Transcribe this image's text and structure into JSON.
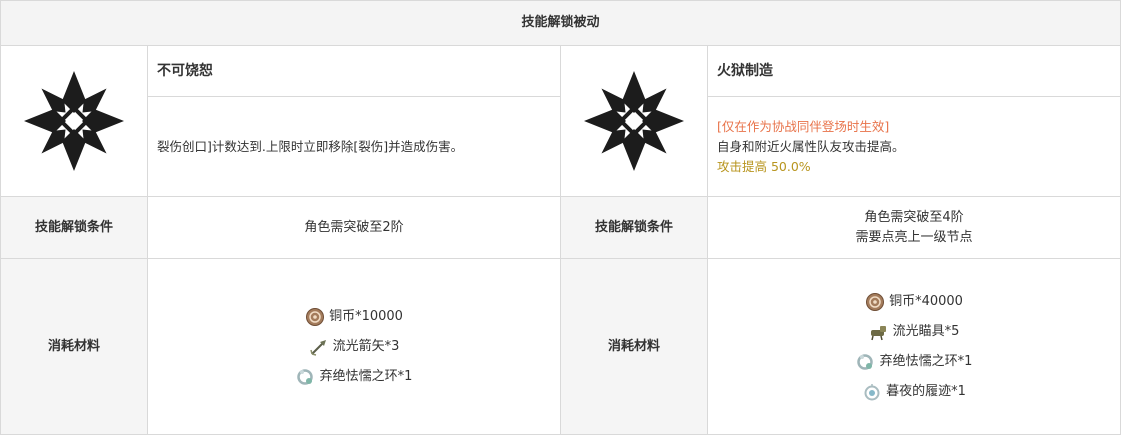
{
  "header": {
    "title": "技能解锁被动"
  },
  "skills": [
    {
      "name": "不可饶恕",
      "icon": "star-emblem-icon",
      "description": "裂伤创口]计数达到.上限时立即移除[裂伤]并造成伤害。",
      "condition_label": "技能解锁条件",
      "conditions": [
        "角色需突破至2阶"
      ],
      "materials_label": "消耗材料",
      "materials": [
        {
          "icon": "copper-coin-icon",
          "text": "铜币*10000"
        },
        {
          "icon": "arrow-icon",
          "text": "流光箭矢*3"
        },
        {
          "icon": "ring-icon",
          "text": "弃绝怯懦之环*1"
        }
      ]
    },
    {
      "name": "火狱制造",
      "icon": "star-emblem-icon",
      "note": "[仅在作为协战同伴登场时生效]",
      "description": "自身和附近火属性队友攻击提高。",
      "bonus": "攻击提高 50.0%",
      "condition_label": "技能解锁条件",
      "conditions": [
        "角色需突破至4阶",
        "需要点亮上一级节点"
      ],
      "materials_label": "消耗材料",
      "materials": [
        {
          "icon": "copper-coin-icon",
          "text": "铜币*40000"
        },
        {
          "icon": "scope-icon",
          "text": "流光瞄具*5"
        },
        {
          "icon": "ring-icon",
          "text": "弃绝怯懦之环*1"
        },
        {
          "icon": "footprint-charm-icon",
          "text": "暮夜的履迹*1"
        }
      ]
    }
  ]
}
